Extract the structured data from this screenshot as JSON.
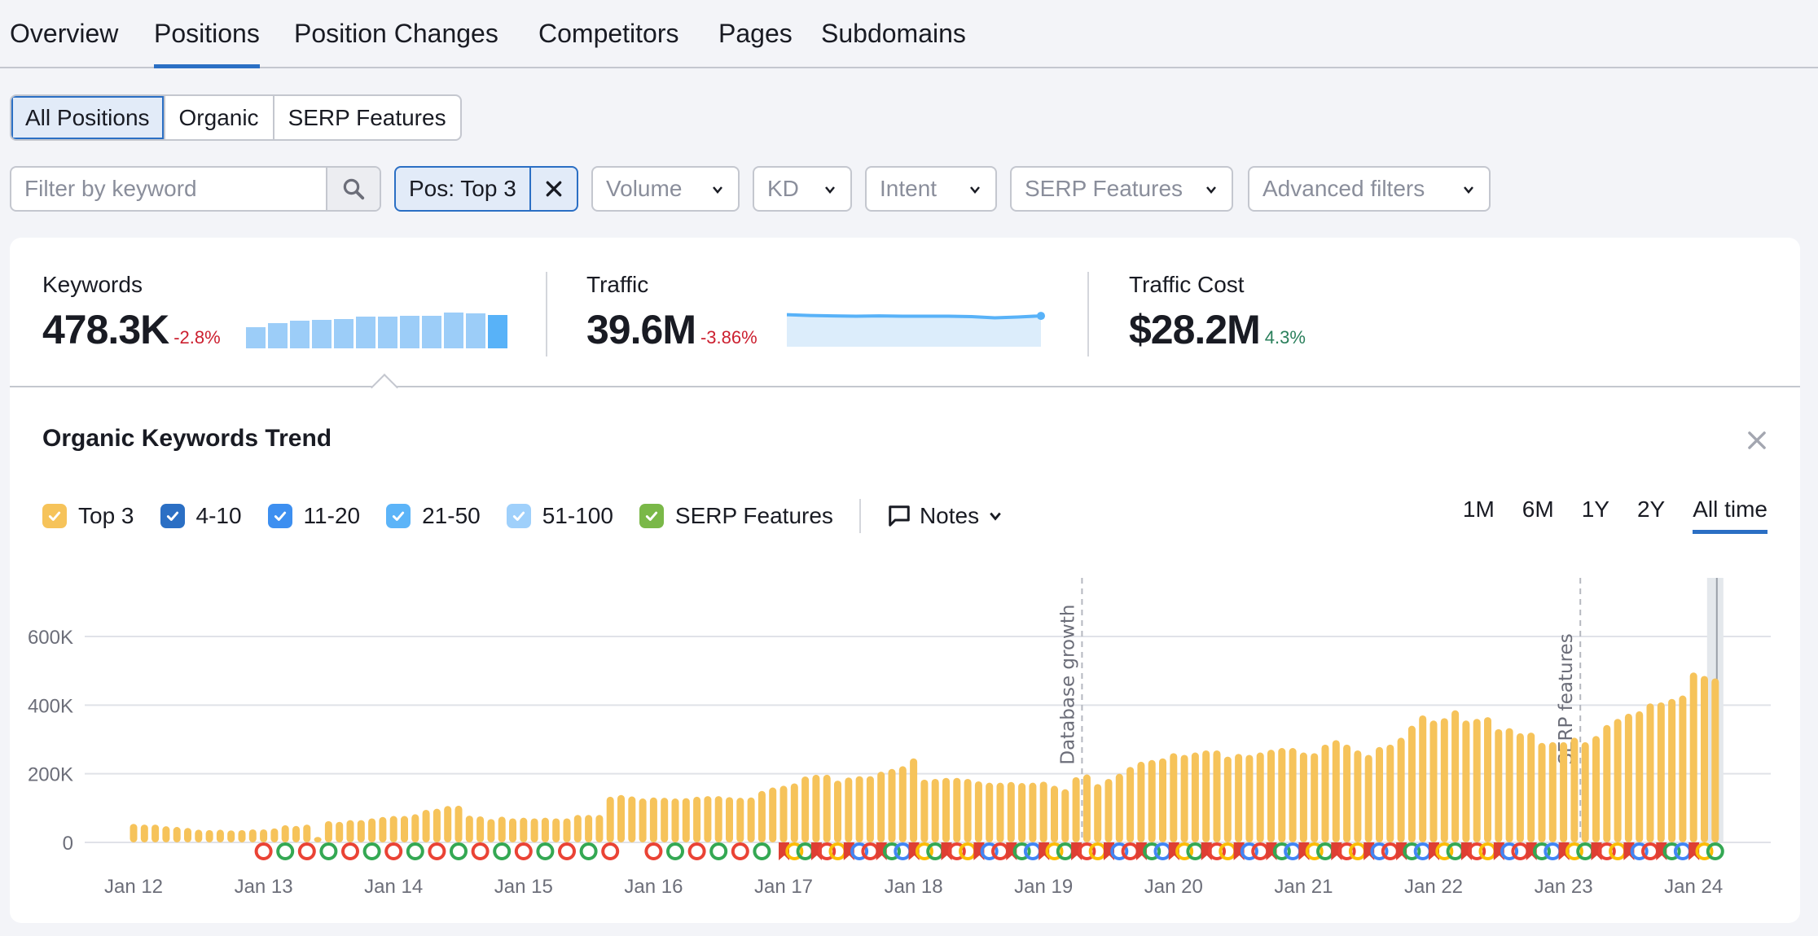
{
  "tabs": [
    {
      "label": "Overview",
      "active": false
    },
    {
      "label": "Positions",
      "active": true
    },
    {
      "label": "Position Changes",
      "active": false
    },
    {
      "label": "Competitors",
      "active": false
    },
    {
      "label": "Pages",
      "active": false
    },
    {
      "label": "Subdomains",
      "active": false
    }
  ],
  "segments": [
    {
      "label": "All Positions",
      "active": true
    },
    {
      "label": "Organic",
      "active": false
    },
    {
      "label": "SERP Features",
      "active": false
    }
  ],
  "filters": {
    "keyword_placeholder": "Filter by keyword",
    "keyword_value": "",
    "active_chip": "Pos: Top 3",
    "dropdowns": [
      "Volume",
      "KD",
      "Intent",
      "SERP Features",
      "Advanced filters"
    ]
  },
  "summary": {
    "keywords": {
      "label": "Keywords",
      "value": "478.3K",
      "delta": "-2.8%",
      "trend": [
        0.6,
        0.7,
        0.78,
        0.8,
        0.82,
        0.88,
        0.88,
        0.9,
        0.92,
        1.0,
        0.97,
        0.94
      ]
    },
    "traffic": {
      "label": "Traffic",
      "value": "39.6M",
      "delta": "-3.86%",
      "trend": [
        0.82,
        0.8,
        0.79,
        0.78,
        0.79,
        0.78,
        0.78,
        0.78,
        0.77,
        0.74,
        0.76,
        0.79
      ]
    },
    "traffic_cost": {
      "label": "Traffic Cost",
      "value": "$28.2M",
      "delta": "4.3%"
    }
  },
  "trend": {
    "title": "Organic Keywords Trend",
    "legend": [
      {
        "label": "Top 3",
        "color": "#f6c35a",
        "checked": true
      },
      {
        "label": "4-10",
        "color": "#2b6fc4",
        "checked": true
      },
      {
        "label": "11-20",
        "color": "#3d8ff0",
        "checked": true
      },
      {
        "label": "21-50",
        "color": "#5cb4f8",
        "checked": true
      },
      {
        "label": "51-100",
        "color": "#9fd0fb",
        "checked": true
      },
      {
        "label": "SERP Features",
        "color": "#7ab848",
        "checked": true
      }
    ],
    "notes_label": "Notes",
    "ranges": [
      {
        "label": "1M",
        "active": false
      },
      {
        "label": "6M",
        "active": false
      },
      {
        "label": "1Y",
        "active": false
      },
      {
        "label": "2Y",
        "active": false
      },
      {
        "label": "All time",
        "active": true
      }
    ]
  },
  "chart_data": {
    "type": "bar",
    "title": "Organic Keywords Trend",
    "series": [
      {
        "name": "Top 3",
        "color": "#f6c35a"
      }
    ],
    "x_start": "Jan 2012",
    "x_interval": "month",
    "xticks": [
      "Jan 12",
      "Jan 13",
      "Jan 14",
      "Jan 15",
      "Jan 16",
      "Jan 17",
      "Jan 18",
      "Jan 19",
      "Jan 20",
      "Jan 21",
      "Jan 22",
      "Jan 23",
      "Jan 24"
    ],
    "yticks": [
      "0",
      "200K",
      "400K",
      "600K"
    ],
    "ylim": [
      0,
      600000
    ],
    "grid": true,
    "values": [
      54000,
      52000,
      52000,
      47000,
      45000,
      42000,
      37000,
      36000,
      37000,
      35000,
      36000,
      38000,
      38000,
      41000,
      50000,
      48000,
      52000,
      16000,
      62000,
      60000,
      65000,
      65000,
      70000,
      74000,
      77000,
      77000,
      82000,
      95000,
      98000,
      106000,
      107000,
      78000,
      76000,
      68000,
      75000,
      70000,
      72000,
      70000,
      72000,
      70000,
      70000,
      80000,
      80000,
      80000,
      133000,
      138000,
      134000,
      128000,
      131000,
      130000,
      128000,
      129000,
      133000,
      135000,
      135000,
      132000,
      130000,
      131000,
      150000,
      160000,
      165000,
      172000,
      192000,
      197000,
      197000,
      180000,
      189000,
      193000,
      193000,
      206000,
      214000,
      222000,
      245000,
      183000,
      185000,
      188000,
      188000,
      185000,
      178000,
      174000,
      174000,
      176000,
      173000,
      174000,
      177000,
      165000,
      155000,
      190000,
      198000,
      170000,
      185000,
      200000,
      220000,
      235000,
      240000,
      245000,
      260000,
      255000,
      262000,
      268000,
      268000,
      250000,
      258000,
      255000,
      262000,
      270000,
      275000,
      275000,
      262000,
      260000,
      285000,
      298000,
      285000,
      268000,
      255000,
      278000,
      285000,
      305000,
      340000,
      370000,
      355000,
      362000,
      385000,
      355000,
      360000,
      365000,
      330000,
      333000,
      318000,
      320000,
      290000,
      292000,
      292000,
      305000,
      292000,
      310000,
      342000,
      360000,
      375000,
      382000,
      405000,
      408000,
      418000,
      428000,
      495000,
      485000,
      478000
    ],
    "annotations": [
      {
        "label": "Database growth",
        "x": "Jan 2019 + 4mo"
      },
      {
        "label": "SERP features",
        "x": "Jan 2023 + 2mo"
      }
    ]
  }
}
